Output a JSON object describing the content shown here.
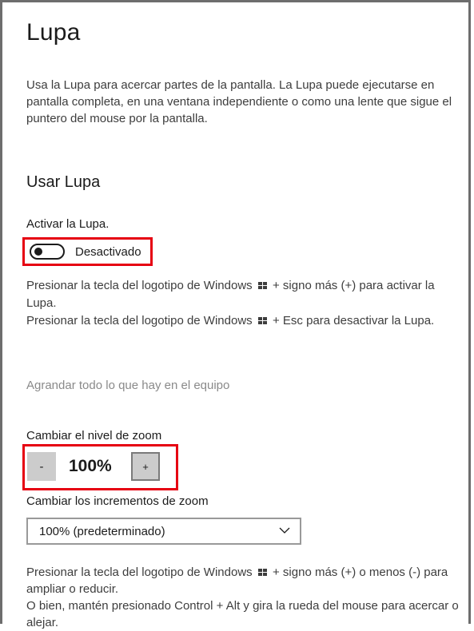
{
  "page": {
    "title": "Lupa",
    "description": "Usa la Lupa para acercar partes de la pantalla. La Lupa puede ejecutarse en pantalla completa, en una ventana independiente o como una lente que sigue el puntero del mouse por la pantalla."
  },
  "use_magnifier": {
    "section_title": "Usar Lupa",
    "activate_label": "Activar la Lupa.",
    "toggle_state": "Desactivado",
    "toggle_on": false,
    "hint_on_pre": "Presionar la tecla del logotipo de Windows",
    "hint_on_post": "+ signo más (+) para activar la Lupa.",
    "hint_off_pre": "Presionar la tecla del logotipo de Windows",
    "hint_off_post": "+ Esc para desactivar la Lupa.",
    "enlarge_link": "Agrandar todo lo que hay en el equipo"
  },
  "zoom": {
    "label": "Cambiar el nivel de zoom",
    "minus_label": "-",
    "value": "100%",
    "plus_label": "+",
    "increments_label": "Cambiar los incrementos de zoom",
    "increments_selected": "100% (predeterminado)",
    "hint1_pre": "Presionar la tecla del logotipo de Windows",
    "hint1_post": "+ signo más (+) o menos (-) para ampliar o reducir.",
    "hint2": "O bien, mantén presionado Control + Alt y gira la rueda del mouse para acercar o alejar."
  },
  "colors": {
    "highlight": "#e60012",
    "text": "#1b1b1b",
    "muted_text": "#3d3d3d",
    "disabled_text": "#8a8a8a",
    "button_bg": "#cccccc"
  },
  "icons": {
    "windows_logo": "windows-logo-icon",
    "chevron": "chevron-down-icon"
  }
}
